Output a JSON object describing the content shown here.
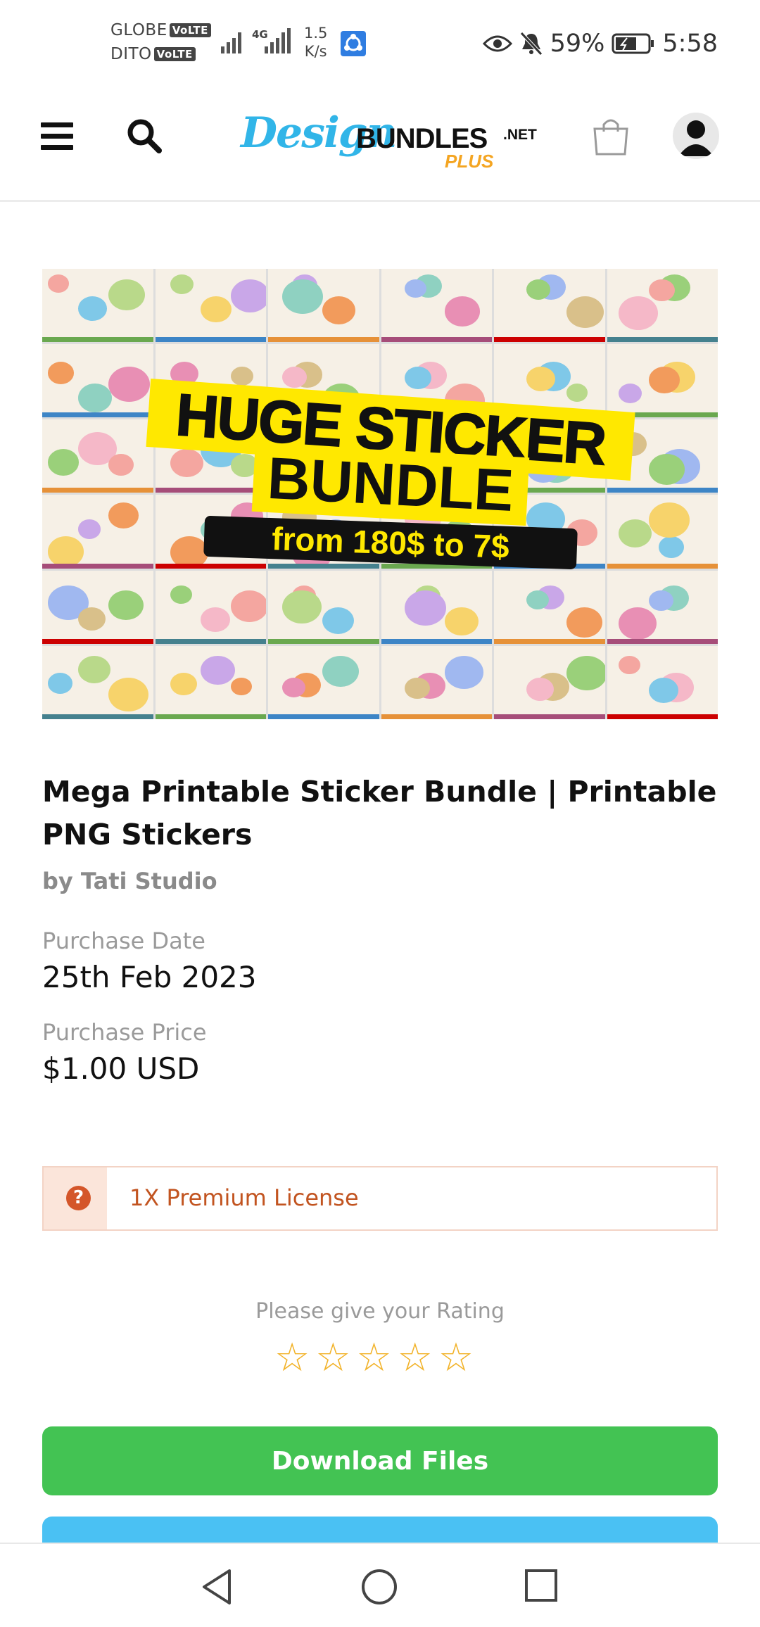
{
  "status_bar": {
    "carrier1": "GLOBE",
    "carrier2": "DITO",
    "volte": "VoLTE",
    "network": "4G",
    "speed_value": "1.5",
    "speed_unit": "K/s",
    "battery": "59%",
    "time": "5:58"
  },
  "header": {
    "logo_design": "Design",
    "logo_bundles": "BUNDLES",
    "logo_net": ".NET",
    "logo_plus": "PLUS"
  },
  "hero": {
    "line1": "HUGE STICKER",
    "line2": "BUNDLE",
    "line3": "from 180$ to 7$"
  },
  "product": {
    "title": "Mega Printable Sticker Bundle | Printable PNG Stickers",
    "by": "by Tati Studio",
    "purchase_date_label": "Purchase Date",
    "purchase_date": "25th Feb 2023",
    "purchase_price_label": "Purchase Price",
    "purchase_price": "$1.00 USD"
  },
  "license": {
    "icon": "?",
    "text": "1X Premium License"
  },
  "rating": {
    "label": "Please give your Rating",
    "max_stars": 5,
    "selected": 0
  },
  "actions": {
    "download_label": "Download Files"
  },
  "colors": {
    "accent_blue": "#31b5e8",
    "green_button": "#43c353",
    "star": "#f2b32a",
    "license_text": "#c25420"
  }
}
